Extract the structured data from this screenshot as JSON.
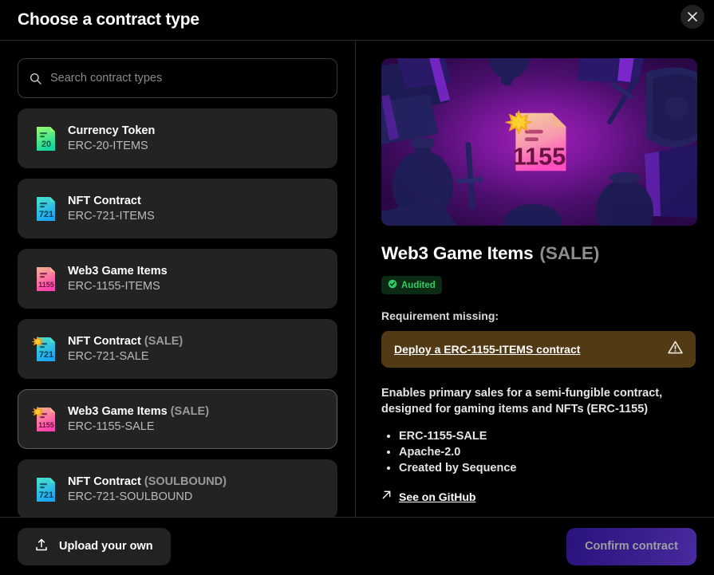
{
  "header": {
    "title": "Choose a contract type",
    "close_label": "close-icon"
  },
  "search": {
    "placeholder": "Search contract types",
    "value": "",
    "icon": "search-icon"
  },
  "contract_types": [
    {
      "name": "Currency Token",
      "variant": "",
      "code": "ERC-20-ITEMS",
      "icon": "erc20-doc-icon",
      "badge_number": "20",
      "selected": false
    },
    {
      "name": "NFT Contract",
      "variant": "",
      "code": "ERC-721-ITEMS",
      "icon": "erc721-doc-icon",
      "badge_number": "721",
      "selected": false
    },
    {
      "name": "Web3 Game Items",
      "variant": "",
      "code": "ERC-1155-ITEMS",
      "icon": "erc1155-doc-icon",
      "badge_number": "1155",
      "selected": false
    },
    {
      "name": "NFT Contract",
      "variant": "(SALE)",
      "code": "ERC-721-SALE",
      "icon": "erc721-sale-icon",
      "badge_number": "721",
      "selected": false
    },
    {
      "name": "Web3 Game Items",
      "variant": "(SALE)",
      "code": "ERC-1155-SALE",
      "icon": "erc1155-sale-icon",
      "badge_number": "1155",
      "selected": true
    },
    {
      "name": "NFT Contract",
      "variant": "(SOULBOUND)",
      "code": "ERC-721-SOULBOUND",
      "icon": "erc721-doc-icon",
      "badge_number": "721",
      "selected": false
    }
  ],
  "detail": {
    "hero_badge_number": "1155",
    "title": "Web3 Game Items",
    "variant": "(SALE)",
    "audited_badge": "Audited",
    "requirement_label": "Requirement missing:",
    "requirement_action": "Deploy a ERC-1155-ITEMS contract",
    "description": "Enables primary sales for a semi-fungible contract, designed for gaming items and NFTs (ERC-1155)",
    "facts": [
      "ERC-1155-SALE",
      "Apache-2.0",
      "Created by Sequence"
    ],
    "github_link": "See on GitHub"
  },
  "footer": {
    "upload_label": "Upload your own",
    "confirm_label": "Confirm contract"
  },
  "colors": {
    "accent_green": "#2ecc64",
    "warning_bg": "#523a14",
    "confirm_gradient_start": "#2a137c",
    "confirm_gradient_end": "#4a2aa0",
    "panel_bg": "#232323",
    "selected_border": "#5d5d5d"
  }
}
